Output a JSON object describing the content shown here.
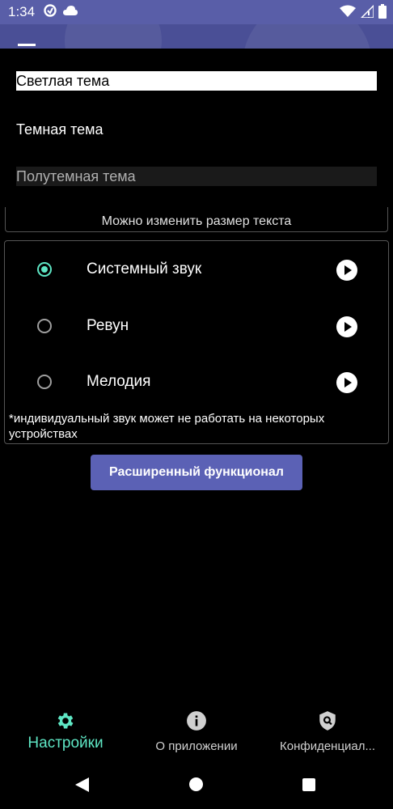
{
  "status_bar": {
    "time": "1:34",
    "left_icons": [
      "data-saver-icon",
      "cloud-icon"
    ],
    "right_icons": [
      "wifi-icon",
      "signal-icon",
      "battery-icon"
    ]
  },
  "theme_menu": {
    "items": [
      {
        "label": "Светлая тема"
      },
      {
        "label": "Темная тема"
      },
      {
        "label": "Полутемная тема"
      }
    ]
  },
  "text_size_hint": "Можно изменить размер текста",
  "sounds": {
    "options": [
      {
        "label": "Системный звук",
        "selected": true
      },
      {
        "label": "Ревун",
        "selected": false
      },
      {
        "label": "Мелодия",
        "selected": false
      }
    ],
    "note": "*индивидуальный звук может не работать на некоторых устройствах"
  },
  "advanced_button": "Расширенный функционал",
  "bottom_nav": [
    {
      "label": "Настройки",
      "icon": "gear-icon",
      "active": true
    },
    {
      "label": "О приложении",
      "icon": "info-icon",
      "active": false
    },
    {
      "label": "Конфиденциал...",
      "icon": "shield-search-icon",
      "active": false
    }
  ],
  "colors": {
    "accent": "#5ee6c4",
    "button": "#5b61b5",
    "status_bar": "#595ea8"
  }
}
